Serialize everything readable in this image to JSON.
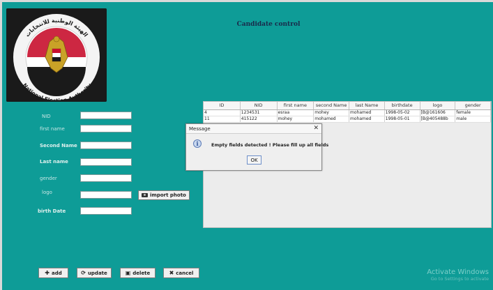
{
  "header": {
    "title": "Candidate control",
    "logo_text_arabic": "الهيئة الوطنية للانتخابات",
    "logo_text_english": "National Election Authority"
  },
  "form": {
    "fields": [
      {
        "label": "NID",
        "value": ""
      },
      {
        "label": "first name",
        "value": ""
      },
      {
        "label": "Second Name",
        "value": ""
      },
      {
        "label": "Last name",
        "value": ""
      },
      {
        "label": "gender",
        "value": ""
      },
      {
        "label": "logo",
        "value": ""
      },
      {
        "label": "birth Date",
        "value": ""
      }
    ],
    "import_photo_label": "import photo"
  },
  "actions": {
    "add": "add",
    "update": "update",
    "delete": "delete",
    "cancel": "cancel"
  },
  "table": {
    "columns": [
      "ID",
      "NID",
      "first name",
      "second Name",
      "last Name",
      "birthdate",
      "logo",
      "gender"
    ],
    "rows": [
      [
        "4",
        "1234531",
        "esraa",
        "mohey",
        "mohamed",
        "1998-05-02",
        "[B@161606",
        "female"
      ],
      [
        "11",
        "415122",
        "mohey",
        "mohamed",
        "mohamed",
        "1998-05-01",
        "[B@405488b",
        "male"
      ]
    ]
  },
  "dialog": {
    "title": "Message",
    "message": "Empty fields detected ! Please fill up all fields",
    "ok_label": "OK",
    "icon": "info-icon"
  },
  "watermark": {
    "line1": "Activate Windows",
    "line2": "Go to Settings to activate"
  },
  "colors": {
    "background": "#0e9c97",
    "logo_bg": "#1a1a1a",
    "dialog_bg": "#efefef"
  }
}
